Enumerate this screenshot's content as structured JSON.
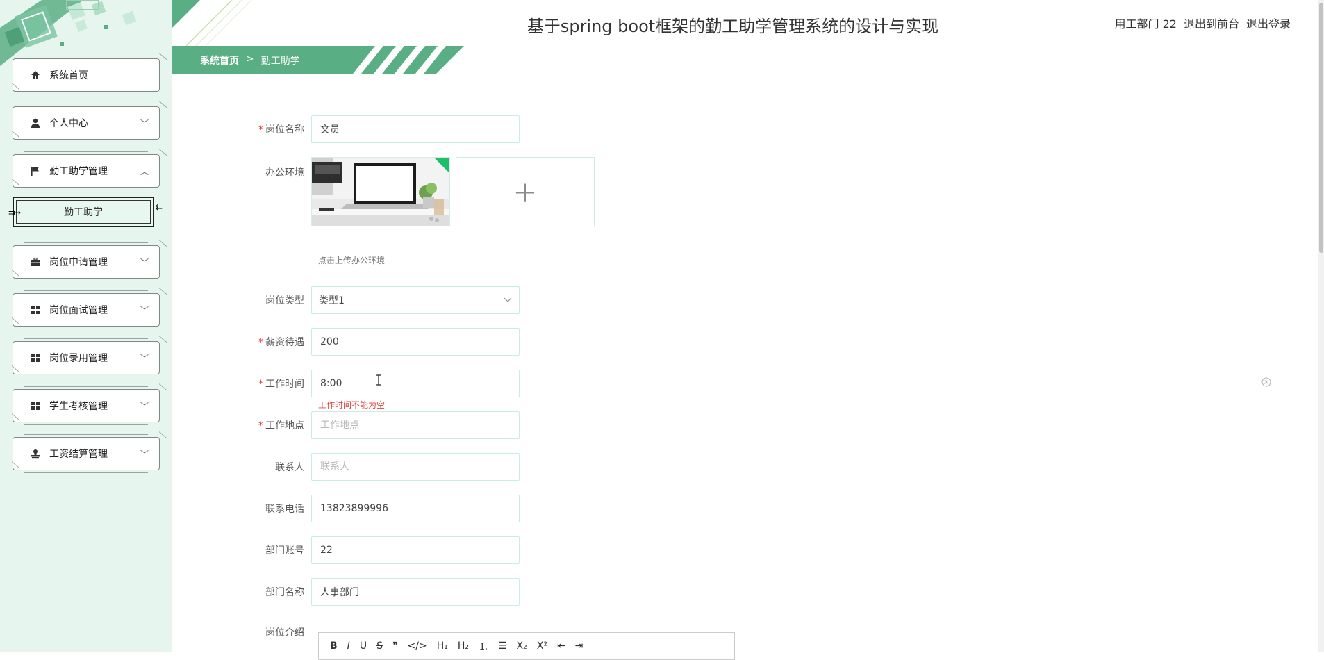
{
  "header": {
    "title": "基于spring boot框架的勤工助学管理系统的设计与实现",
    "user": "用工部门 22",
    "to_front": "退出到前台",
    "logout": "退出登录"
  },
  "breadcrumb": {
    "home": "系统首页",
    "sep": ">",
    "current": "勤工助学"
  },
  "sidebar": {
    "items": [
      {
        "label": "系统首页",
        "icon": "home-icon",
        "chevron": ""
      },
      {
        "label": "个人中心",
        "icon": "user-icon",
        "chevron": "﹀"
      },
      {
        "label": "勤工助学管理",
        "icon": "flag-icon",
        "chevron": "︿"
      },
      {
        "label": "岗位申请管理",
        "icon": "briefcase-icon",
        "chevron": "﹀"
      },
      {
        "label": "岗位面试管理",
        "icon": "grid-icon",
        "chevron": "﹀"
      },
      {
        "label": "岗位录用管理",
        "icon": "grid-icon",
        "chevron": "﹀"
      },
      {
        "label": "学生考核管理",
        "icon": "grid-icon",
        "chevron": "﹀"
      },
      {
        "label": "工资结算管理",
        "icon": "stamp-icon",
        "chevron": "﹀"
      }
    ],
    "subitem": "勤工助学"
  },
  "form": {
    "job_name": {
      "label": "岗位名称",
      "value": "文员",
      "required": true
    },
    "office_env": {
      "label": "办公环境",
      "hint": "点击上传办公环境"
    },
    "job_type": {
      "label": "岗位类型",
      "value": "类型1"
    },
    "salary": {
      "label": "薪资待遇",
      "value": "200",
      "required": true
    },
    "work_time": {
      "label": "工作时间",
      "value": "8:00",
      "required": true,
      "error": "工作时间不能为空"
    },
    "work_place": {
      "label": "工作地点",
      "value": "",
      "placeholder": "工作地点",
      "required": true
    },
    "contact": {
      "label": "联系人",
      "value": "",
      "placeholder": "联系人"
    },
    "phone": {
      "label": "联系电话",
      "value": "13823899996"
    },
    "dept_account": {
      "label": "部门账号",
      "value": "22"
    },
    "dept_name": {
      "label": "部门名称",
      "value": "人事部门"
    },
    "job_intro": {
      "label": "岗位介绍"
    },
    "required_mark": "*",
    "upload_plus": "+"
  },
  "editor_toolbar": [
    "B",
    "I",
    "U",
    "S",
    "❞",
    "</>",
    "H₁",
    "H₂",
    "⒈",
    "☰",
    "X₂",
    "X²",
    "⇤",
    "⇥"
  ],
  "colors": {
    "accent": "#5aae84",
    "sidebar_bg": "#e6f6ef",
    "error": "#e64340",
    "input_border": "#c9ede0"
  }
}
